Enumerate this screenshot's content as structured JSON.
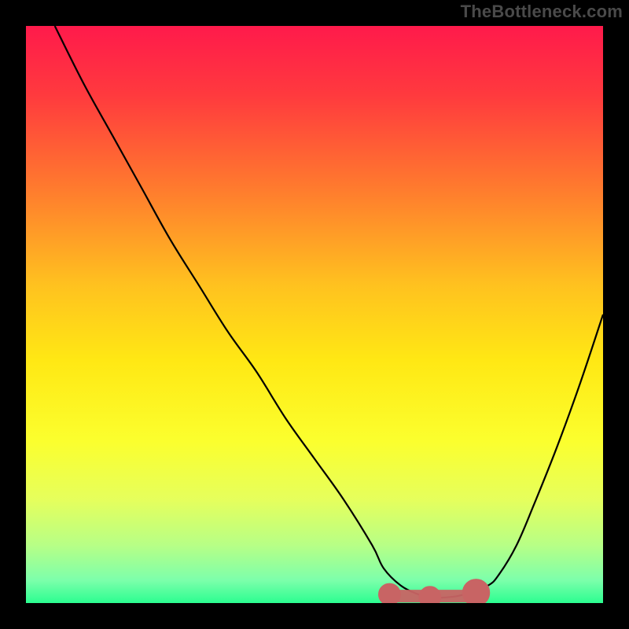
{
  "watermark": "TheBottleneck.com",
  "colors": {
    "frame": "#000000",
    "watermark_color": "#4a4a4a",
    "curve": "#000000",
    "marker_fill": "#c86464",
    "marker_stroke": "#c86464",
    "gradient_stops": [
      {
        "offset": 0.0,
        "color": "#ff1a4b"
      },
      {
        "offset": 0.12,
        "color": "#ff3a3e"
      },
      {
        "offset": 0.28,
        "color": "#ff7a2e"
      },
      {
        "offset": 0.45,
        "color": "#ffc21f"
      },
      {
        "offset": 0.58,
        "color": "#ffe814"
      },
      {
        "offset": 0.72,
        "color": "#fbff2e"
      },
      {
        "offset": 0.82,
        "color": "#e6ff5c"
      },
      {
        "offset": 0.9,
        "color": "#b7ff86"
      },
      {
        "offset": 0.96,
        "color": "#7dffab"
      },
      {
        "offset": 1.0,
        "color": "#2bfd90"
      }
    ]
  },
  "chart_data": {
    "type": "line",
    "title": "",
    "xlabel": "",
    "ylabel": "",
    "xlim": [
      0,
      100
    ],
    "ylim": [
      0,
      100
    ],
    "series": [
      {
        "name": "bottleneck-curve",
        "x": [
          5,
          10,
          15,
          20,
          25,
          30,
          35,
          40,
          45,
          50,
          55,
          60,
          62,
          65,
          68,
          70,
          73,
          76,
          80,
          82,
          85,
          88,
          92,
          96,
          100
        ],
        "values": [
          100,
          90,
          81,
          72,
          63,
          55,
          47,
          40,
          32,
          25,
          18,
          10,
          6,
          3,
          1.5,
          1,
          1,
          1.5,
          3,
          5,
          10,
          17,
          27,
          38,
          50
        ]
      }
    ],
    "markers": [
      {
        "name": "optimal-range-left-cap",
        "x": 63,
        "y": 1.5,
        "r": 1.5
      },
      {
        "name": "optimal-range-midpoint",
        "x": 70,
        "y": 1.0,
        "r": 1.5
      },
      {
        "name": "optimal-range-right-cap",
        "x": 78,
        "y": 1.8,
        "r": 2.0
      }
    ],
    "optimal_band": {
      "x_start": 63,
      "x_end": 78,
      "y": 1.2,
      "thickness": 2.2
    }
  }
}
